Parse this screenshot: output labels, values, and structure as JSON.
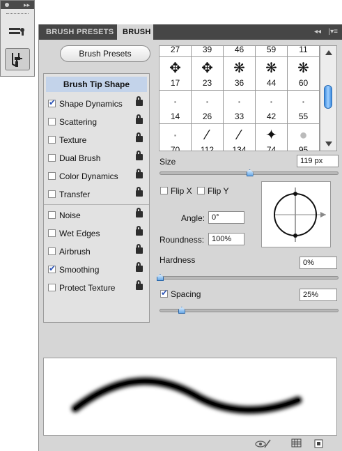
{
  "tabs": [
    {
      "label": "BRUSH PRESETS",
      "active": false
    },
    {
      "label": "BRUSH",
      "active": true
    }
  ],
  "panel_menu": {
    "collapse_icon": "double-chevron-left-icon",
    "menu_icon": "panel-menu-icon"
  },
  "dock": {
    "tools": [
      {
        "name": "brush-presets-dock-icon",
        "active": false
      },
      {
        "name": "brush-panel-dock-icon",
        "active": true
      }
    ]
  },
  "brush_presets_button": "Brush Presets",
  "options": [
    {
      "label": "Brush Tip Shape",
      "selected": true
    },
    {
      "label": "Shape Dynamics",
      "checked": true,
      "lock": true
    },
    {
      "label": "Scattering",
      "checked": false,
      "lock": true
    },
    {
      "label": "Texture",
      "checked": false,
      "lock": true
    },
    {
      "label": "Dual Brush",
      "checked": false,
      "lock": true
    },
    {
      "label": "Color Dynamics",
      "checked": false,
      "lock": true
    },
    {
      "label": "Transfer",
      "checked": false,
      "lock": true
    },
    {
      "label": "Noise",
      "checked": false,
      "lock": true
    },
    {
      "label": "Wet Edges",
      "checked": false,
      "lock": true
    },
    {
      "label": "Airbrush",
      "checked": false,
      "lock": true
    },
    {
      "label": "Smoothing",
      "checked": true,
      "lock": true
    },
    {
      "label": "Protect Texture",
      "checked": false,
      "lock": true
    }
  ],
  "tip_grid": [
    {
      "size": "27",
      "shape": "partial"
    },
    {
      "size": "39",
      "shape": "partial"
    },
    {
      "size": "46",
      "shape": "partial"
    },
    {
      "size": "59",
      "shape": "partial"
    },
    {
      "size": "11",
      "shape": "partial"
    },
    {
      "size": "17",
      "shape": "scatter-leaf"
    },
    {
      "size": "23",
      "shape": "scatter-leaf"
    },
    {
      "size": "36",
      "shape": "scatter-grass"
    },
    {
      "size": "44",
      "shape": "scatter-grass"
    },
    {
      "size": "60",
      "shape": "scatter-grass"
    },
    {
      "size": "14",
      "shape": "soft-dot"
    },
    {
      "size": "26",
      "shape": "soft-dot"
    },
    {
      "size": "33",
      "shape": "soft-dot"
    },
    {
      "size": "42",
      "shape": "soft-dot"
    },
    {
      "size": "55",
      "shape": "soft-dot"
    },
    {
      "size": "70",
      "shape": "soft-dot"
    },
    {
      "size": "112",
      "shape": "grass-blade"
    },
    {
      "size": "134",
      "shape": "grass-blade"
    },
    {
      "size": "74",
      "shape": "maple-leaf"
    },
    {
      "size": "95",
      "shape": "blob"
    }
  ],
  "size": {
    "label": "Size",
    "value": "119 px",
    "slider_fraction": 0.5
  },
  "flip_x": {
    "label": "Flip X",
    "checked": false
  },
  "flip_y": {
    "label": "Flip Y",
    "checked": false
  },
  "angle": {
    "label": "Angle:",
    "value": "0°"
  },
  "roundness": {
    "label": "Roundness:",
    "value": "100%"
  },
  "hardness": {
    "label": "Hardness",
    "value": "0%",
    "slider_fraction": 0.0
  },
  "spacing": {
    "label": "Spacing",
    "value": "25%",
    "checked": true,
    "slider_fraction": 0.12
  },
  "footer_icons": [
    "brush-toggle-icon",
    "grid-icon",
    "new-preset-icon"
  ]
}
